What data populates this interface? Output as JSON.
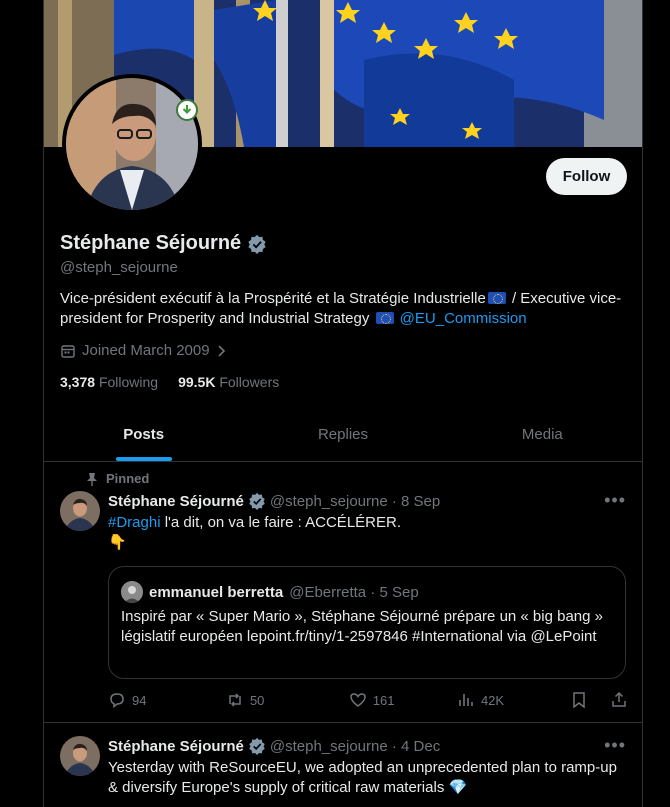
{
  "profile": {
    "name": "Stéphane Séjourné",
    "handle": "@steph_sejourne",
    "bio_part1": "Vice-président exécutif à la Prospérité et la Stratégie Industrielle",
    "bio_part2": " / Executive vice-president for Prosperity and Industrial Strategy ",
    "bio_mention": "@EU_Commission",
    "joined": "Joined March 2009",
    "following_count": "3,378",
    "following_label": "Following",
    "followers_count": "99.5K",
    "followers_label": "Followers",
    "follow_button": "Follow"
  },
  "tabs": [
    {
      "label": "Posts"
    },
    {
      "label": "Replies"
    },
    {
      "label": "Media"
    }
  ],
  "posts": [
    {
      "pinned_label": "Pinned",
      "name": "Stéphane Séjourné",
      "meta": "@steph_sejourne · 8 Sep",
      "hashtag": "#Draghi",
      "text_rest": " l'a dit, on va le faire : ACCÉLÉRER.",
      "emoji": "👇",
      "quote": {
        "name": "emmanuel berretta",
        "meta": "@Eberretta · 5 Sep",
        "text": "Inspiré par « Super Mario », Stéphane Séjourné prépare un « big bang » législatif européen lepoint.fr/tiny/1-2597846 #International via @LePoint"
      },
      "replies": "94",
      "reposts": "50",
      "likes": "161",
      "views": "42K"
    },
    {
      "name": "Stéphane Séjourné",
      "meta": "@steph_sejourne · 4 Dec",
      "text": "Yesterday with ReSourceEU, we adopted an unprecedented plan to ramp-up & diversify Europe's supply of critical raw materials 💎"
    }
  ],
  "icons": {
    "verified": "verified-badge-icon",
    "calendar": "calendar-icon",
    "chevron": "chevron-right-icon",
    "pin": "pin-icon",
    "more": "more-icon",
    "reply": "reply-icon",
    "repost": "repost-icon",
    "like": "heart-icon",
    "views": "views-icon",
    "bookmark": "bookmark-icon",
    "share": "share-icon"
  },
  "colors": {
    "accent": "#1d9bf0",
    "background": "#000000",
    "muted": "#71767b"
  }
}
